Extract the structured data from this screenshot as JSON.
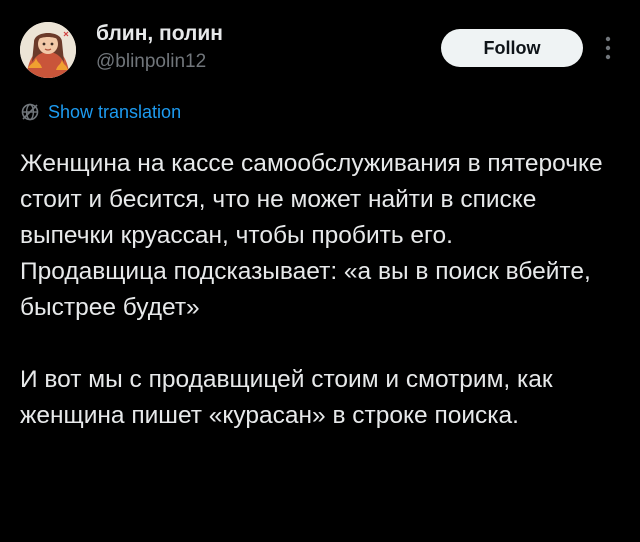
{
  "author": {
    "display_name": "блин, полин",
    "handle": "@blinpolin12",
    "avatar_icon": "avatar-illustration"
  },
  "actions": {
    "follow_label": "Follow",
    "more_icon": "more-vertical-icon"
  },
  "translation": {
    "icon": "globe-icon",
    "label": "Show translation"
  },
  "tweet": {
    "paragraphs": [
      "Женщина на кассе самообслуживания в пятерочке стоит и бесится, что не может найти в списке выпечки круассан, чтобы пробить его.",
      "Продавщица подсказывает: «а вы в поиск вбейте, быстрее будет»",
      "И вот мы с продавщицей стоим и смотрим, как женщина пишет «курасан» в строке поиска."
    ]
  },
  "colors": {
    "background": "#000000",
    "text_primary": "#e7e9ea",
    "text_secondary": "#71767b",
    "link": "#1d9bf0",
    "button_bg": "#eff3f4",
    "button_text": "#0f1419"
  }
}
